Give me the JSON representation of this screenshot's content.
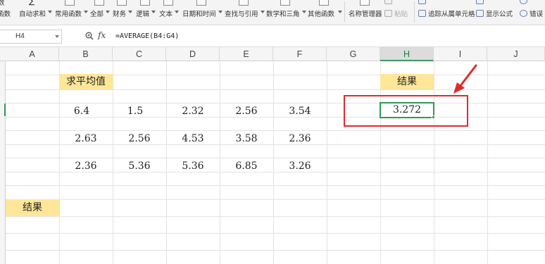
{
  "ribbon": {
    "left_cut_labels": [
      "数",
      "函数"
    ],
    "items": [
      {
        "label": "自动求和",
        "has_caret": true
      },
      {
        "label": "常用函数",
        "has_caret": true
      },
      {
        "label": "全部",
        "has_caret": true
      },
      {
        "label": "财务",
        "has_caret": true
      },
      {
        "label": "逻辑",
        "has_caret": true
      },
      {
        "label": "文本",
        "has_caret": true
      },
      {
        "label": "日期和时间",
        "has_caret": true
      },
      {
        "label": "查找与引用",
        "has_caret": true
      },
      {
        "label": "数学和三角",
        "has_caret": true
      },
      {
        "label": "其他函数",
        "has_caret": true
      }
    ],
    "name_manager": "名称管理器",
    "paste": "粘贴",
    "trace_dependents": "追踪从属单元格",
    "show_formulas": "显示公式",
    "error_check": "错误"
  },
  "formula_bar": {
    "name_box": "H4",
    "fx": "fx",
    "formula": "=AVERAGE(B4:G4)"
  },
  "columns": [
    "A",
    "B",
    "C",
    "D",
    "E",
    "F",
    "G",
    "H",
    "I",
    "J"
  ],
  "active_column": "H",
  "cells": {
    "title_avg": "求平均值",
    "result_header": "结果",
    "result_value": "3.272",
    "result_label": "结果",
    "rows": [
      [
        "6.4",
        "1.5",
        "2.32",
        "2.56",
        "3.54"
      ],
      [
        "2.63",
        "2.56",
        "4.53",
        "3.58",
        "2.36"
      ],
      [
        "2.36",
        "5.36",
        "5.36",
        "6.85",
        "3.26"
      ]
    ]
  },
  "colors": {
    "highlight": "#ffe699",
    "selection": "#2f9a52",
    "annotation": "#e02a2a"
  }
}
